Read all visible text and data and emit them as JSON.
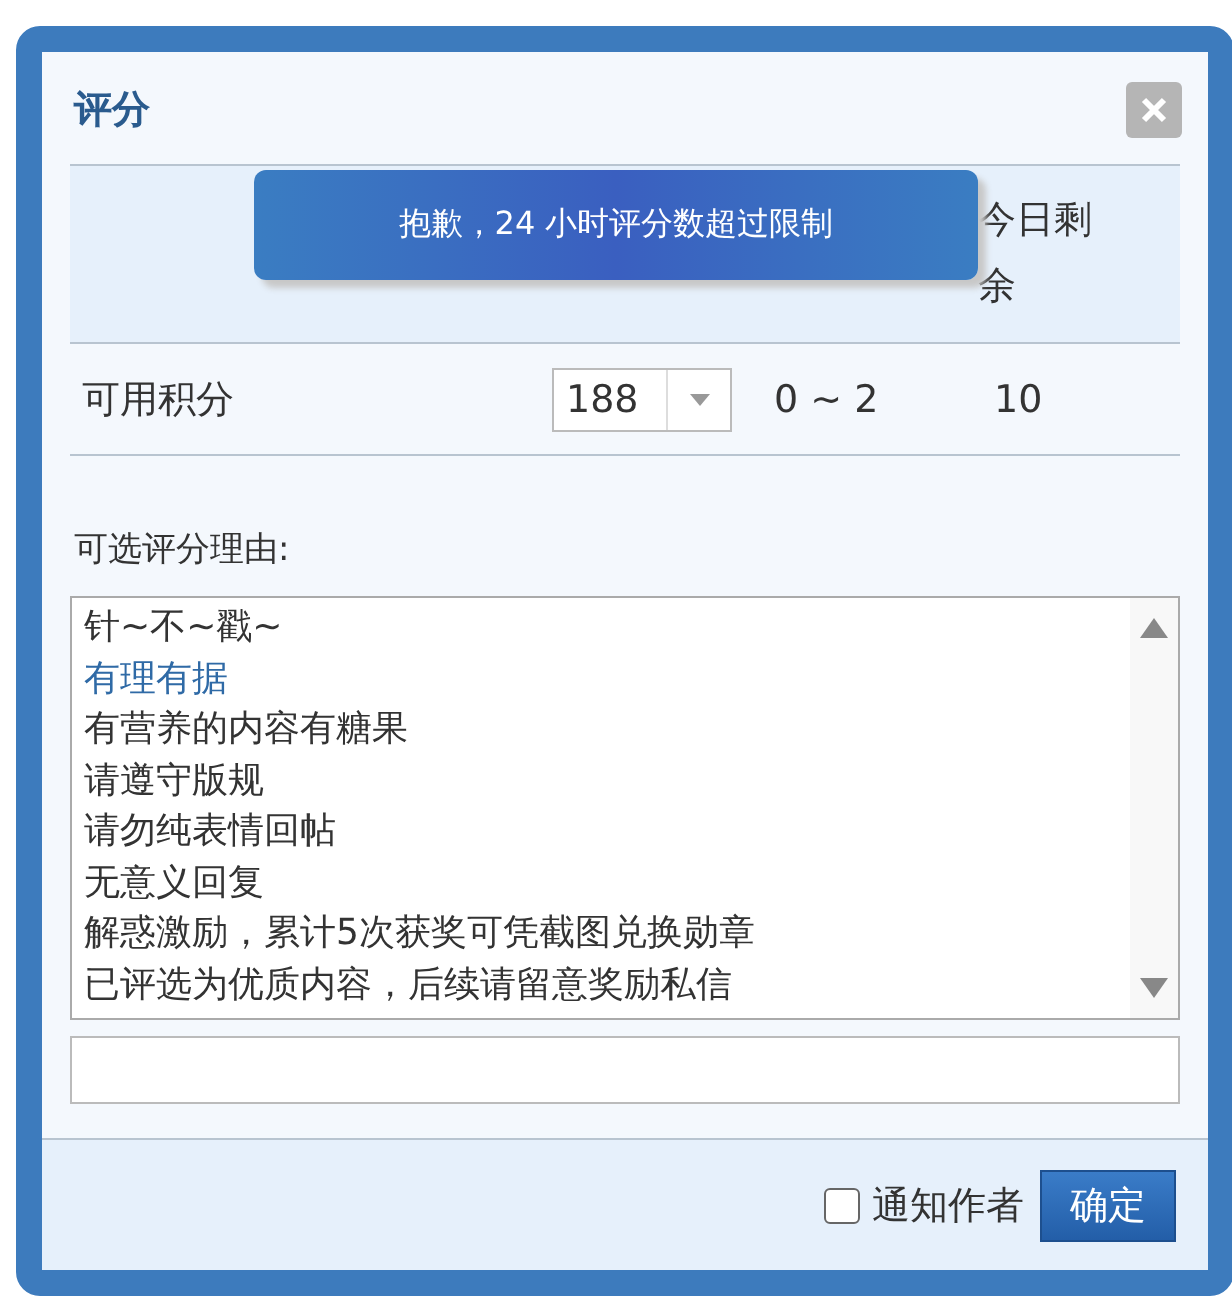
{
  "dialog": {
    "title": "评分"
  },
  "toast": {
    "text": "抱歉，24 小时评分数超过限制"
  },
  "table": {
    "header": {
      "column_4": "今日剩余"
    },
    "row": {
      "label": "可用积分",
      "select_value": "188",
      "range": "0 ~ 2",
      "remaining": "10"
    }
  },
  "reasons": {
    "label": "可选评分理由:",
    "items": [
      {
        "text": "针~不~戳~",
        "selected": false
      },
      {
        "text": "有理有据",
        "selected": true
      },
      {
        "text": "有营养的内容有糖果",
        "selected": false
      },
      {
        "text": "请遵守版规",
        "selected": false
      },
      {
        "text": "请勿纯表情回帖",
        "selected": false
      },
      {
        "text": "无意义回复",
        "selected": false
      },
      {
        "text": "解惑激励，累计5次获奖可凭截图兑换勋章",
        "selected": false
      },
      {
        "text": "已评选为优质内容，后续请留意奖励私信",
        "selected": false
      }
    ]
  },
  "footer": {
    "notify": {
      "label": "通知作者",
      "checked": false
    },
    "confirm": "确定"
  }
}
